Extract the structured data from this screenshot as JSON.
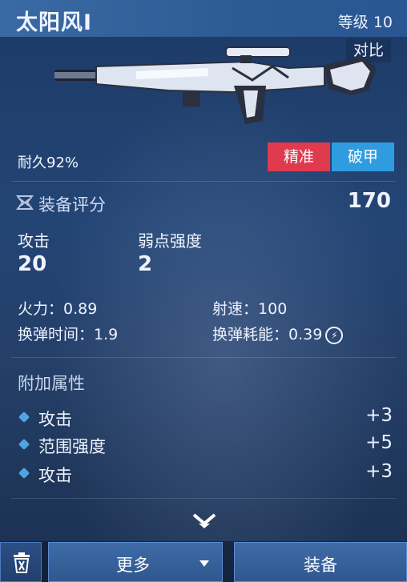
{
  "header": {
    "title": "太阳风I",
    "level": "等级 10"
  },
  "compare_label": "对比",
  "weapon": {
    "durability": "耐久92%",
    "tags": [
      "精准",
      "破甲"
    ],
    "image": "sniper-rifle"
  },
  "score": {
    "label": "装备评分",
    "value": "170",
    "icon": "score-emblem-icon"
  },
  "primary_stats": [
    {
      "label": "攻击",
      "value": "20"
    },
    {
      "label": "弱点强度",
      "value": "2"
    }
  ],
  "secondary_stats": [
    {
      "label": "火力：",
      "value": "0.89"
    },
    {
      "label": "射速：",
      "value": "100"
    },
    {
      "label": "换弹时间：",
      "value": "1.9"
    },
    {
      "label": "换弹耗能：",
      "value": "0.39"
    }
  ],
  "extra_attributes": {
    "title": "附加属性",
    "items": [
      {
        "name": "攻击",
        "value": "+3"
      },
      {
        "name": "范围强度",
        "value": "+5"
      },
      {
        "name": "攻击",
        "value": "+3"
      }
    ]
  },
  "bottom_bar": {
    "more_label": "更多",
    "equip_label": "装备"
  },
  "colors": {
    "precision_tag": "#e03a4f",
    "armor_break_tag": "#2f9ce0",
    "bullet": "#4ea5e4"
  }
}
